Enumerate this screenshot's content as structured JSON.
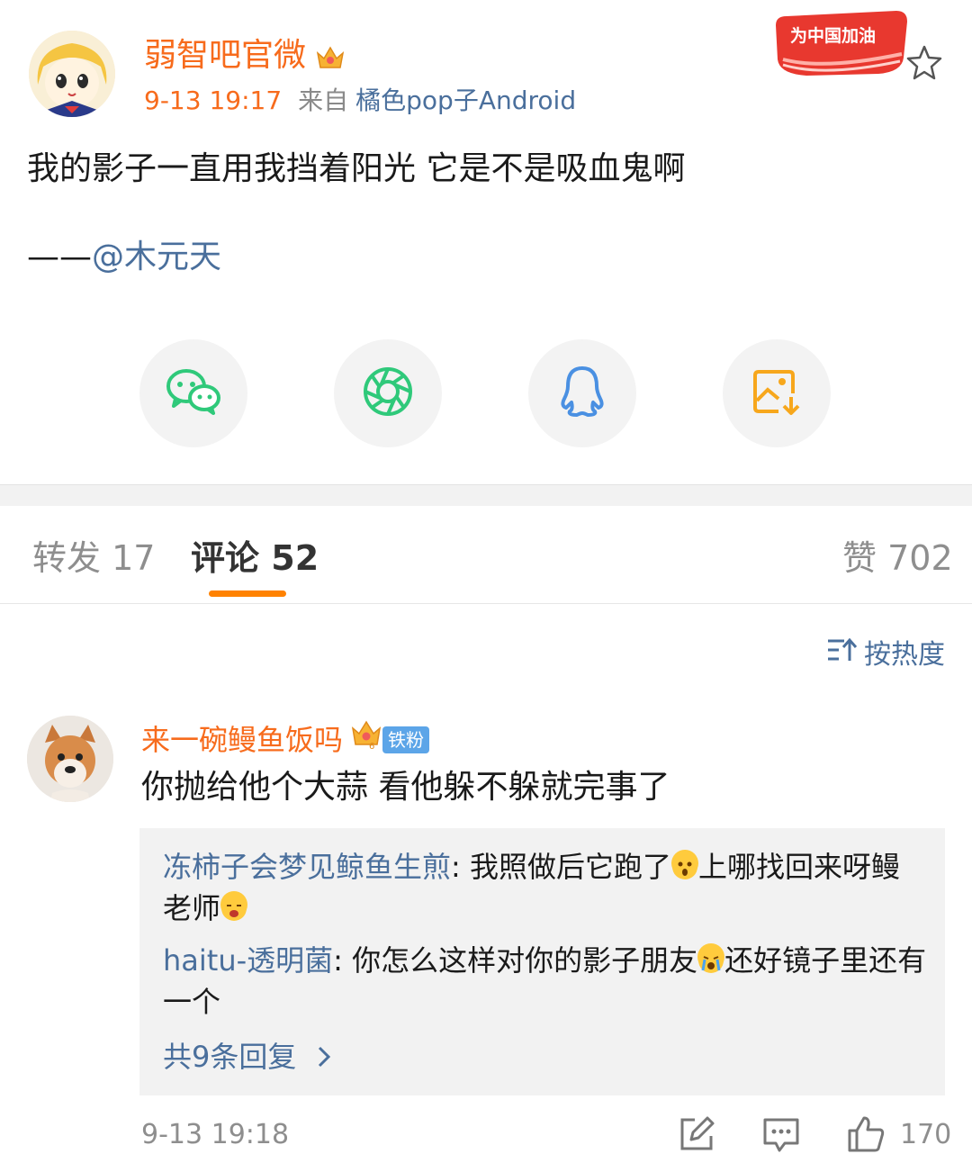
{
  "post": {
    "author": "弱智吧官微",
    "time": "9-13 19:17",
    "from_label": "来自",
    "source": "橘色pop子Android",
    "badge_text": "为中国加油",
    "text": "我的影子一直用我挡着阳光 它是不是吸血鬼啊",
    "credit_prefix": "——",
    "credit_mention": "@木元天"
  },
  "share": {
    "items": [
      "wechat-icon",
      "moments-icon",
      "qq-icon",
      "save-image-icon"
    ],
    "colors": {
      "wechat": "#2fc97a",
      "moments": "#2fc97a",
      "qq": "#4a90e2",
      "save": "#f7a71c"
    }
  },
  "tabs": {
    "repost_label": "转发",
    "repost_count": "17",
    "comment_label": "评论",
    "comment_count": "52",
    "like_label": "赞",
    "like_count": "702"
  },
  "sort": {
    "label": "按热度"
  },
  "comment": {
    "author": "来一碗鳗鱼饭吗",
    "fan_tag": "铁粉",
    "text": "你抛给他个大蒜 看他躲不躲就完事了",
    "replies": [
      {
        "name": "冻柿子会梦见鲸鱼生煎",
        "text_a": ": 我照做后它跑了",
        "text_b": "上哪找回来呀鳗老师"
      },
      {
        "name": "haitu-透明菌",
        "text_a": ": 你怎么这样对你的影子朋友",
        "text_b": "还好镜子里还有一个"
      }
    ],
    "more_replies": "共9条回复",
    "time": "9-13 19:18",
    "likes": "170"
  },
  "colors": {
    "accent": "#f76b1c",
    "link": "#4a6f9c",
    "tab_underline": "#ff8200"
  }
}
